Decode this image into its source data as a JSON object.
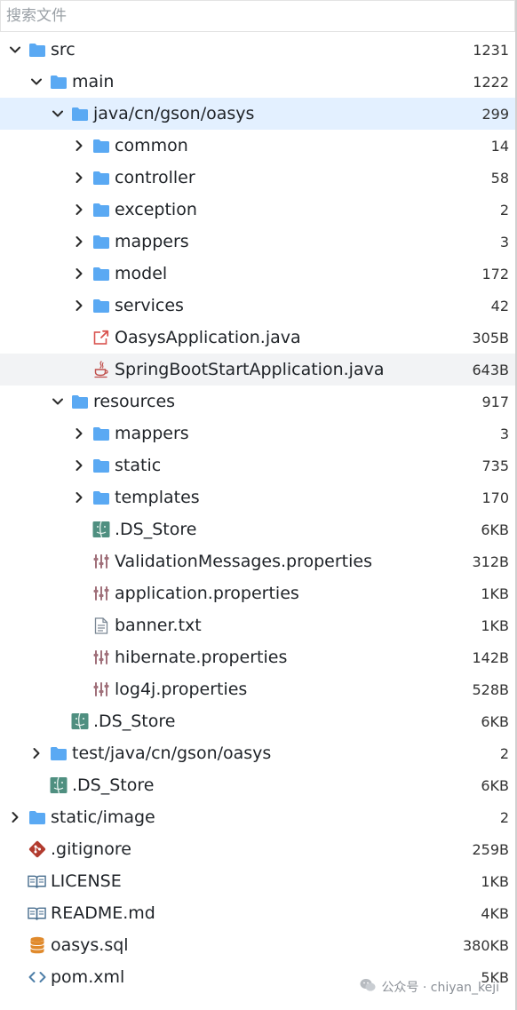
{
  "search": {
    "placeholder": "搜索文件"
  },
  "tree": [
    {
      "name": "src",
      "count": "1231",
      "depth": 0,
      "type": "folder",
      "state": "open"
    },
    {
      "name": "main",
      "count": "1222",
      "depth": 1,
      "type": "folder",
      "state": "open"
    },
    {
      "name": "java/cn/gson/oasys",
      "count": "299",
      "depth": 2,
      "type": "folder",
      "state": "open",
      "selected": true
    },
    {
      "name": "common",
      "count": "14",
      "depth": 3,
      "type": "folder",
      "state": "closed"
    },
    {
      "name": "controller",
      "count": "58",
      "depth": 3,
      "type": "folder",
      "state": "closed"
    },
    {
      "name": "exception",
      "count": "2",
      "depth": 3,
      "type": "folder",
      "state": "closed"
    },
    {
      "name": "mappers",
      "count": "3",
      "depth": 3,
      "type": "folder",
      "state": "closed"
    },
    {
      "name": "model",
      "count": "172",
      "depth": 3,
      "type": "folder",
      "state": "closed"
    },
    {
      "name": "services",
      "count": "42",
      "depth": 3,
      "type": "folder",
      "state": "closed"
    },
    {
      "name": "OasysApplication.java",
      "count": "305B",
      "depth": 3,
      "type": "java-link"
    },
    {
      "name": "SpringBootStartApplication.java",
      "count": "643B",
      "depth": 3,
      "type": "java",
      "hover": true
    },
    {
      "name": "resources",
      "count": "917",
      "depth": 2,
      "type": "folder",
      "state": "open"
    },
    {
      "name": "mappers",
      "count": "3",
      "depth": 3,
      "type": "folder",
      "state": "closed"
    },
    {
      "name": "static",
      "count": "735",
      "depth": 3,
      "type": "folder",
      "state": "closed"
    },
    {
      "name": "templates",
      "count": "170",
      "depth": 3,
      "type": "folder",
      "state": "closed"
    },
    {
      "name": ".DS_Store",
      "count": "6KB",
      "depth": 3,
      "type": "finder"
    },
    {
      "name": "ValidationMessages.properties",
      "count": "312B",
      "depth": 3,
      "type": "properties"
    },
    {
      "name": "application.properties",
      "count": "1KB",
      "depth": 3,
      "type": "properties"
    },
    {
      "name": "banner.txt",
      "count": "1KB",
      "depth": 3,
      "type": "text"
    },
    {
      "name": "hibernate.properties",
      "count": "142B",
      "depth": 3,
      "type": "properties"
    },
    {
      "name": "log4j.properties",
      "count": "528B",
      "depth": 3,
      "type": "properties"
    },
    {
      "name": ".DS_Store",
      "count": "6KB",
      "depth": 2,
      "type": "finder"
    },
    {
      "name": "test/java/cn/gson/oasys",
      "count": "2",
      "depth": 1,
      "type": "folder",
      "state": "closed"
    },
    {
      "name": ".DS_Store",
      "count": "6KB",
      "depth": 1,
      "type": "finder"
    },
    {
      "name": "static/image",
      "count": "2",
      "depth": 0,
      "type": "folder",
      "state": "closed"
    },
    {
      "name": ".gitignore",
      "count": "259B",
      "depth": 0,
      "type": "git"
    },
    {
      "name": "LICENSE",
      "count": "1KB",
      "depth": 0,
      "type": "book"
    },
    {
      "name": "README.md",
      "count": "4KB",
      "depth": 0,
      "type": "book"
    },
    {
      "name": "oasys.sql",
      "count": "380KB",
      "depth": 0,
      "type": "database"
    },
    {
      "name": "pom.xml",
      "count": "5KB",
      "depth": 0,
      "type": "code"
    }
  ],
  "watermark": {
    "text": "公众号 · chiyan_keji"
  },
  "colors": {
    "folder": "#5aa9f3",
    "chevron": "#2b2b2b",
    "selected_row": "#e3f0ff",
    "hover_row": "#f2f3f5",
    "java_link": "#d9534f",
    "java_cup": "#c0504d",
    "finder": "#4f8f80",
    "properties": "#a0707a",
    "git": "#b23b2e",
    "book": "#4a6f8f",
    "database": "#e08a2c",
    "code": "#4f7fa8"
  },
  "icons": {
    "folder": "folder-icon",
    "chevron_open": "chevron-down-icon",
    "chevron_closed": "chevron-right-icon",
    "java-link": "java-file-link-icon",
    "java": "java-file-icon",
    "finder": "ds-store-icon",
    "properties": "properties-file-icon",
    "text": "text-file-icon",
    "git": "git-icon",
    "book": "book-icon",
    "database": "database-icon",
    "code": "code-icon"
  }
}
